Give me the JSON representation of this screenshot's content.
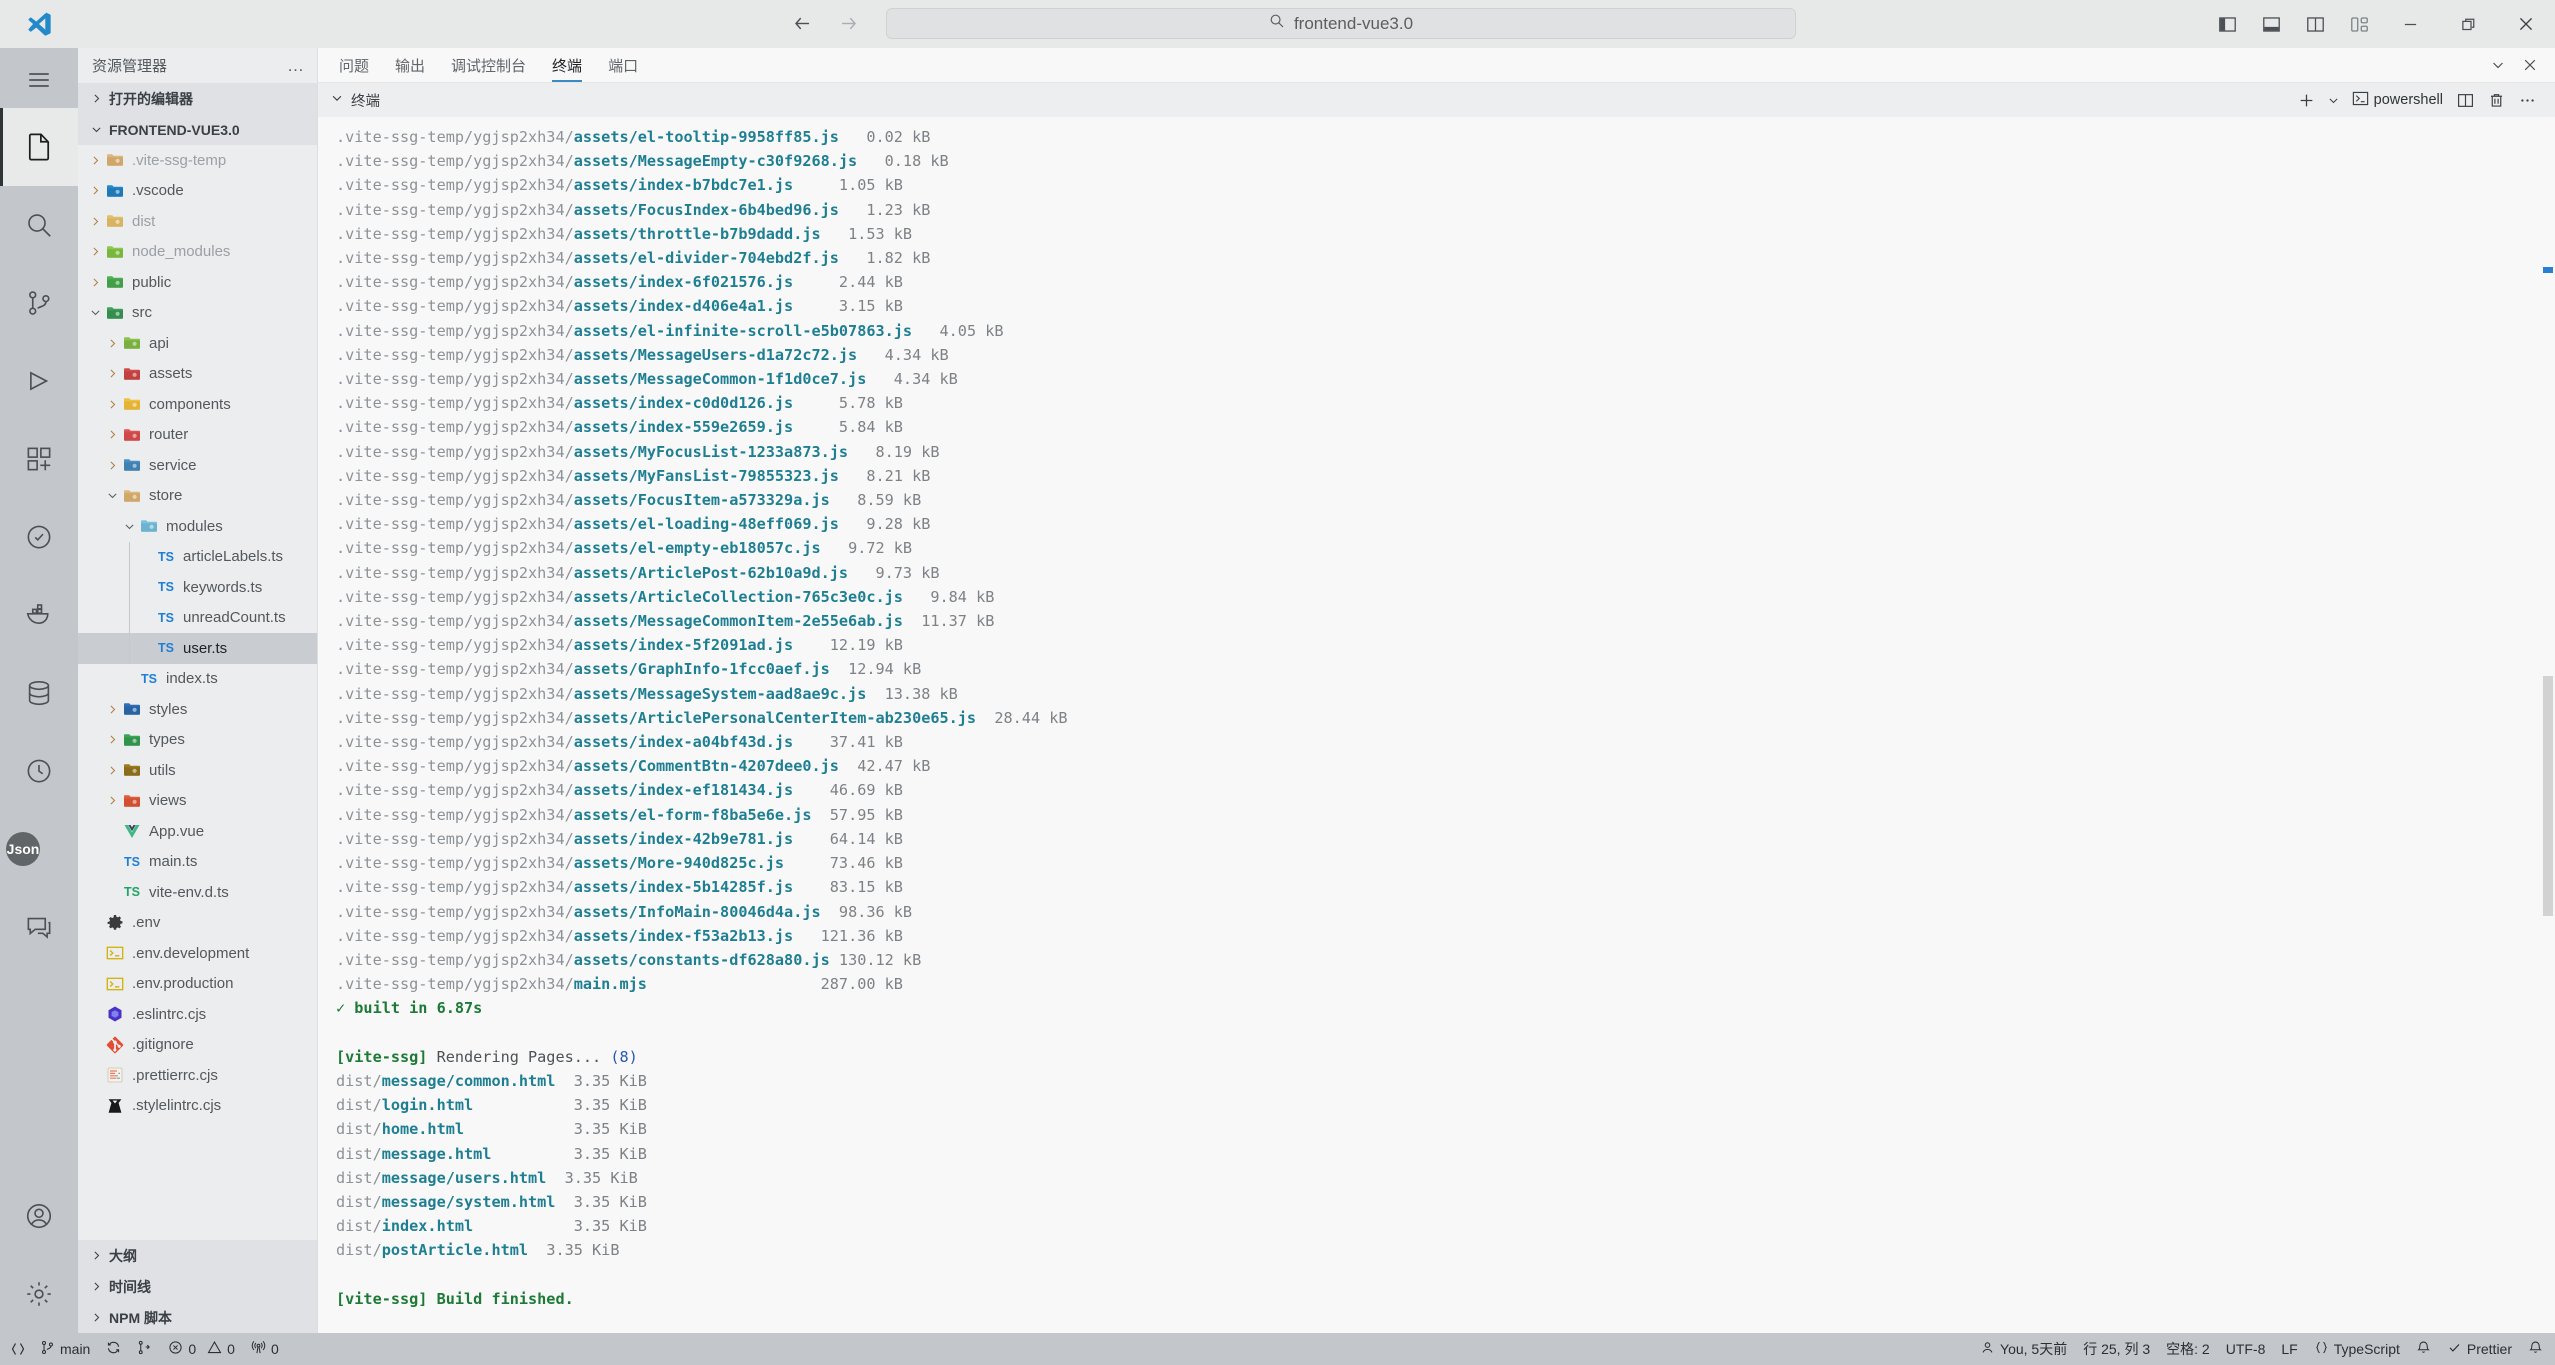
{
  "titlebar": {
    "logo_icon": "vscode-logo-icon",
    "back_icon": "arrow-left-icon",
    "forward_icon": "arrow-right-icon",
    "command_center": {
      "search_icon": "search-icon",
      "text": "frontend-vue3.0"
    },
    "layout_buttons": [
      {
        "name": "toggle-primary-sidebar-button",
        "icon": "layout-sidebar-left-icon"
      },
      {
        "name": "toggle-panel-button",
        "icon": "layout-panel-bottom-icon"
      },
      {
        "name": "toggle-secondary-sidebar-button",
        "icon": "layout-sidebar-right-icon"
      },
      {
        "name": "customize-layout-button",
        "icon": "layout-customize-icon"
      }
    ],
    "window_buttons": [
      {
        "name": "minimize-button",
        "icon": "minimize-icon"
      },
      {
        "name": "restore-button",
        "icon": "restore-icon"
      },
      {
        "name": "close-button",
        "icon": "close-icon"
      }
    ]
  },
  "activitybar": {
    "menu_icon": "hamburger-menu-icon",
    "items": [
      {
        "name": "activity-explorer",
        "icon": "files-icon",
        "active": true
      },
      {
        "name": "activity-search",
        "icon": "search-icon",
        "active": false
      },
      {
        "name": "activity-source-control",
        "icon": "source-control-icon",
        "active": false
      },
      {
        "name": "activity-run-debug",
        "icon": "debug-icon",
        "active": false
      },
      {
        "name": "activity-extensions",
        "icon": "extensions-icon",
        "active": false
      },
      {
        "name": "activity-testing",
        "icon": "beaker-icon",
        "active": false
      },
      {
        "name": "activity-docker",
        "icon": "docker-icon",
        "active": false
      },
      {
        "name": "activity-database",
        "icon": "database-icon",
        "active": false
      },
      {
        "name": "activity-gitlens",
        "icon": "gitlens-icon",
        "active": false
      },
      {
        "name": "activity-json",
        "badge": "Json",
        "icon": "json-icon",
        "active": false
      },
      {
        "name": "activity-chat",
        "icon": "comment-discussion-icon",
        "active": false
      }
    ],
    "bottom_items": [
      {
        "name": "activity-accounts",
        "icon": "account-icon"
      },
      {
        "name": "activity-settings",
        "icon": "gear-icon"
      }
    ]
  },
  "sidebar": {
    "title": "资源管理器",
    "more_actions": "…",
    "open_editors_label": "打开的编辑器",
    "workspace_label": "FRONTEND-VUE3.0",
    "tree": [
      {
        "label": ".vite-ssg-temp",
        "indent": 1,
        "type": "folder",
        "icon": "folder-generic-icon",
        "expandable": true,
        "expanded": false,
        "dim": true
      },
      {
        "label": ".vscode",
        "indent": 1,
        "type": "folder",
        "icon": "folder-vscode-icon",
        "expandable": true,
        "expanded": false,
        "dim": false
      },
      {
        "label": "dist",
        "indent": 1,
        "type": "folder",
        "icon": "folder-dist-icon",
        "expandable": true,
        "expanded": false,
        "dim": true
      },
      {
        "label": "node_modules",
        "indent": 1,
        "type": "folder",
        "icon": "folder-node-icon",
        "expandable": true,
        "expanded": false,
        "dim": true
      },
      {
        "label": "public",
        "indent": 1,
        "type": "folder",
        "icon": "folder-public-icon",
        "expandable": true,
        "expanded": false,
        "dim": false
      },
      {
        "label": "src",
        "indent": 1,
        "type": "folder",
        "icon": "folder-src-icon",
        "expandable": true,
        "expanded": true,
        "dim": false
      },
      {
        "label": "api",
        "indent": 2,
        "type": "folder",
        "icon": "folder-api-icon",
        "expandable": true,
        "expanded": false,
        "dim": false
      },
      {
        "label": "assets",
        "indent": 2,
        "type": "folder",
        "icon": "folder-assets-icon",
        "expandable": true,
        "expanded": false,
        "dim": false
      },
      {
        "label": "components",
        "indent": 2,
        "type": "folder",
        "icon": "folder-components-icon",
        "expandable": true,
        "expanded": false,
        "dim": false
      },
      {
        "label": "router",
        "indent": 2,
        "type": "folder",
        "icon": "folder-router-icon",
        "expandable": true,
        "expanded": false,
        "dim": false
      },
      {
        "label": "service",
        "indent": 2,
        "type": "folder",
        "icon": "folder-service-icon",
        "expandable": true,
        "expanded": false,
        "dim": false
      },
      {
        "label": "store",
        "indent": 2,
        "type": "folder",
        "icon": "folder-generic-icon",
        "expandable": true,
        "expanded": true,
        "dim": false
      },
      {
        "label": "modules",
        "indent": 3,
        "type": "folder",
        "icon": "folder-modules-icon",
        "expandable": true,
        "expanded": true,
        "dim": false
      },
      {
        "label": "articleLabels.ts",
        "indent": 4,
        "type": "file",
        "icon": "typescript-file-icon",
        "expandable": false,
        "dim": false
      },
      {
        "label": "keywords.ts",
        "indent": 4,
        "type": "file",
        "icon": "typescript-file-icon",
        "expandable": false,
        "dim": false
      },
      {
        "label": "unreadCount.ts",
        "indent": 4,
        "type": "file",
        "icon": "typescript-file-icon",
        "expandable": false,
        "dim": false
      },
      {
        "label": "user.ts",
        "indent": 4,
        "type": "file",
        "icon": "typescript-file-icon",
        "expandable": false,
        "dim": false,
        "selected": true
      },
      {
        "label": "index.ts",
        "indent": 3,
        "type": "file",
        "icon": "typescript-file-icon",
        "expandable": false,
        "dim": false
      },
      {
        "label": "styles",
        "indent": 2,
        "type": "folder",
        "icon": "folder-styles-icon",
        "expandable": true,
        "expanded": false,
        "dim": false
      },
      {
        "label": "types",
        "indent": 2,
        "type": "folder",
        "icon": "folder-types-icon",
        "expandable": true,
        "expanded": false,
        "dim": false
      },
      {
        "label": "utils",
        "indent": 2,
        "type": "folder",
        "icon": "folder-utils-icon",
        "expandable": true,
        "expanded": false,
        "dim": false
      },
      {
        "label": "views",
        "indent": 2,
        "type": "folder",
        "icon": "folder-views-icon",
        "expandable": true,
        "expanded": false,
        "dim": false
      },
      {
        "label": "App.vue",
        "indent": 2,
        "type": "file",
        "icon": "vue-file-icon",
        "expandable": false,
        "dim": false
      },
      {
        "label": "main.ts",
        "indent": 2,
        "type": "file",
        "icon": "typescript-file-icon",
        "expandable": false,
        "dim": false
      },
      {
        "label": "vite-env.d.ts",
        "indent": 2,
        "type": "file",
        "icon": "typescript-def-file-icon",
        "expandable": false,
        "dim": false
      },
      {
        "label": ".env",
        "indent": 1,
        "type": "file",
        "icon": "gear-file-icon",
        "expandable": false,
        "dim": false
      },
      {
        "label": ".env.development",
        "indent": 1,
        "type": "file",
        "icon": "console-file-icon",
        "expandable": false,
        "dim": false
      },
      {
        "label": ".env.production",
        "indent": 1,
        "type": "file",
        "icon": "console-file-icon",
        "expandable": false,
        "dim": false
      },
      {
        "label": ".eslintrc.cjs",
        "indent": 1,
        "type": "file",
        "icon": "eslint-file-icon",
        "expandable": false,
        "dim": false
      },
      {
        "label": ".gitignore",
        "indent": 1,
        "type": "file",
        "icon": "git-file-icon",
        "expandable": false,
        "dim": false
      },
      {
        "label": ".prettierrc.cjs",
        "indent": 1,
        "type": "file",
        "icon": "prettier-file-icon",
        "expandable": false,
        "dim": false
      },
      {
        "label": ".stylelintrc.cjs",
        "indent": 1,
        "type": "file",
        "icon": "stylelint-file-icon",
        "expandable": false,
        "dim": false
      }
    ],
    "bottom_sections": [
      {
        "label": "大纲",
        "name": "sidebar-section-outline"
      },
      {
        "label": "时间线",
        "name": "sidebar-section-timeline"
      },
      {
        "label": "NPM 脚本",
        "name": "sidebar-section-npm-scripts"
      }
    ]
  },
  "panel": {
    "tabs": [
      {
        "label": "问题",
        "name": "tab-problems",
        "active": false
      },
      {
        "label": "输出",
        "name": "tab-output",
        "active": false
      },
      {
        "label": "调试控制台",
        "name": "tab-debug-console",
        "active": false
      },
      {
        "label": "终端",
        "name": "tab-terminal",
        "active": true
      },
      {
        "label": "端口",
        "name": "tab-ports",
        "active": false
      }
    ],
    "actions": [
      {
        "name": "panel-chevron-down-button",
        "icon": "chevron-down-icon"
      },
      {
        "name": "panel-close-button",
        "icon": "close-icon"
      }
    ],
    "terminal_header": {
      "chevron_icon": "chevron-down-icon",
      "label": "终端",
      "new_terminal_icon": "plus-icon",
      "new_terminal_dropdown_icon": "chevron-down-icon",
      "shell_icon": "terminal-powershell-icon",
      "shell_name": "powershell",
      "split_icon": "split-editor-icon",
      "kill_icon": "trash-icon",
      "more_icon": "ellipsis-icon"
    }
  },
  "terminal": {
    "asset_prefix": ".vite-ssg-temp/ygjsp2xh34/",
    "assets": [
      {
        "path": "assets/el-tooltip-9958ff85.js",
        "size": "0.02 kB"
      },
      {
        "path": "assets/MessageEmpty-c30f9268.js",
        "size": "0.18 kB"
      },
      {
        "path": "assets/index-b7bdc7e1.js",
        "size": "1.05 kB"
      },
      {
        "path": "assets/FocusIndex-6b4bed96.js",
        "size": "1.23 kB"
      },
      {
        "path": "assets/throttle-b7b9dadd.js",
        "size": "1.53 kB"
      },
      {
        "path": "assets/el-divider-704ebd2f.js",
        "size": "1.82 kB"
      },
      {
        "path": "assets/index-6f021576.js",
        "size": "2.44 kB"
      },
      {
        "path": "assets/index-d406e4a1.js",
        "size": "3.15 kB"
      },
      {
        "path": "assets/el-infinite-scroll-e5b07863.js",
        "size": "4.05 kB"
      },
      {
        "path": "assets/MessageUsers-d1a72c72.js",
        "size": "4.34 kB"
      },
      {
        "path": "assets/MessageCommon-1f1d0ce7.js",
        "size": "4.34 kB"
      },
      {
        "path": "assets/index-c0d0d126.js",
        "size": "5.78 kB"
      },
      {
        "path": "assets/index-559e2659.js",
        "size": "5.84 kB"
      },
      {
        "path": "assets/MyFocusList-1233a873.js",
        "size": "8.19 kB"
      },
      {
        "path": "assets/MyFansList-79855323.js",
        "size": "8.21 kB"
      },
      {
        "path": "assets/FocusItem-a573329a.js",
        "size": "8.59 kB"
      },
      {
        "path": "assets/el-loading-48eff069.js",
        "size": "9.28 kB"
      },
      {
        "path": "assets/el-empty-eb18057c.js",
        "size": "9.72 kB"
      },
      {
        "path": "assets/ArticlePost-62b10a9d.js",
        "size": "9.73 kB"
      },
      {
        "path": "assets/ArticleCollection-765c3e0c.js",
        "size": "9.84 kB"
      },
      {
        "path": "assets/MessageCommonItem-2e55e6ab.js",
        "size": "11.37 kB"
      },
      {
        "path": "assets/index-5f2091ad.js",
        "size": "12.19 kB"
      },
      {
        "path": "assets/GraphInfo-1fcc0aef.js",
        "size": "12.94 kB"
      },
      {
        "path": "assets/MessageSystem-aad8ae9c.js",
        "size": "13.38 kB"
      },
      {
        "path": "assets/ArticlePersonalCenterItem-ab230e65.js",
        "size": "28.44 kB"
      },
      {
        "path": "assets/index-a04bf43d.js",
        "size": "37.41 kB"
      },
      {
        "path": "assets/CommentBtn-4207dee0.js",
        "size": "42.47 kB"
      },
      {
        "path": "assets/index-ef181434.js",
        "size": "46.69 kB"
      },
      {
        "path": "assets/el-form-f8ba5e6e.js",
        "size": "57.95 kB"
      },
      {
        "path": "assets/index-42b9e781.js",
        "size": "64.14 kB"
      },
      {
        "path": "assets/More-940d825c.js",
        "size": "73.46 kB"
      },
      {
        "path": "assets/index-5b14285f.js",
        "size": "83.15 kB"
      },
      {
        "path": "assets/InfoMain-80046d4a.js",
        "size": "98.36 kB"
      },
      {
        "path": "assets/index-f53a2b13.js",
        "size": "121.36 kB"
      },
      {
        "path": "assets/constants-df628a80.js",
        "size": "130.12 kB"
      },
      {
        "path": "main.mjs",
        "size": "287.00 kB"
      }
    ],
    "built_line": "✓ built in 6.87s",
    "rendering_tag": "[vite-ssg]",
    "rendering_text": " Rendering Pages... ",
    "rendering_count": "(8)",
    "pages": [
      {
        "dir": "dist/",
        "file": "message/common.html",
        "size": "3.35 KiB",
        "pad": 2
      },
      {
        "dir": "dist/",
        "file": "login.html",
        "size": "3.35 KiB",
        "pad": 11
      },
      {
        "dir": "dist/",
        "file": "home.html",
        "size": "3.35 KiB",
        "pad": 12
      },
      {
        "dir": "dist/",
        "file": "message.html",
        "size": "3.35 KiB",
        "pad": 9
      },
      {
        "dir": "dist/",
        "file": "message/users.html",
        "size": "3.35 KiB",
        "pad": 2
      },
      {
        "dir": "dist/",
        "file": "message/system.html",
        "size": "3.35 KiB",
        "pad": 2
      },
      {
        "dir": "dist/",
        "file": "index.html",
        "size": "3.35 KiB",
        "pad": 11
      },
      {
        "dir": "dist/",
        "file": "postArticle.html",
        "size": "3.35 KiB",
        "pad": 2
      }
    ],
    "finished_tag": "[vite-ssg]",
    "finished_text": " Build finished."
  },
  "statusbar": {
    "remote_icon": "remote-indicator-icon",
    "branch_icon": "source-control-branch-icon",
    "branch": "main",
    "sync_icon": "sync-icon",
    "changes_icon": "git-changes-icon",
    "errors_icon": "error-icon",
    "errors": "0",
    "warnings_icon": "warning-icon",
    "warnings": "0",
    "ports_icon": "radio-tower-icon",
    "ports": "0",
    "bell_icon": "bell-icon",
    "right": {
      "account_icon": "account-icon",
      "account_text": "You, 5天前",
      "cursor": "行 25, 列 3",
      "indent": "空格: 2",
      "encoding": "UTF-8",
      "eol": "LF",
      "brackets_icon": "brackets-icon",
      "language": "TypeScript",
      "notification_icon": "bell-icon",
      "prettier_check_icon": "check-icon",
      "prettier": "Prettier"
    }
  },
  "colors": {
    "accent": "#3b8ac4",
    "terminal_cyan": "#1f7f92",
    "terminal_green": "#1d7a36",
    "terminal_blue": "#2657b5",
    "statusbar_bg": "#c3c7cc"
  }
}
